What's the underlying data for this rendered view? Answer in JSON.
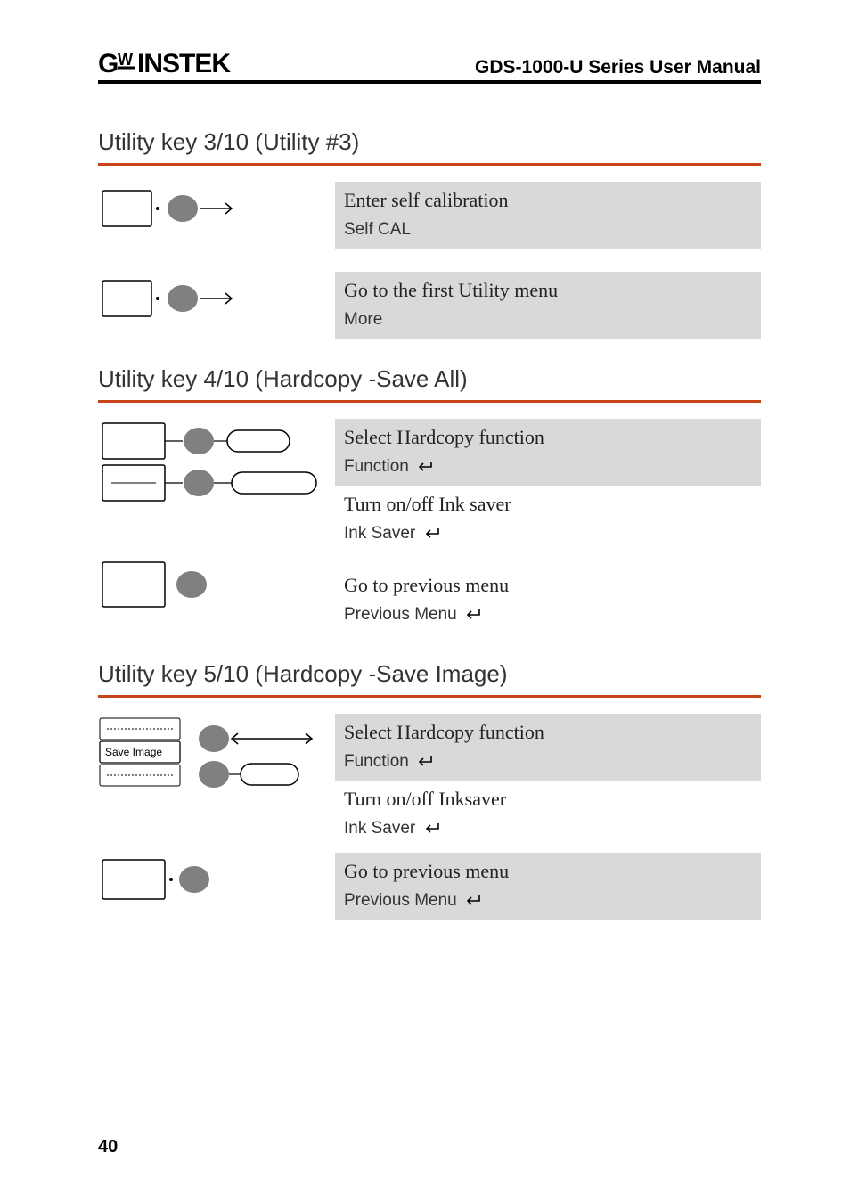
{
  "header": {
    "brand_prefix": "G",
    "brand_super": "W",
    "brand_rest": "INSTEK",
    "manual_title": "GDS-1000-U Series User Manual"
  },
  "sections": [
    {
      "title": "Utility key 3/10 (Utility #3)",
      "rows": [
        {
          "top": "Enter self calibration",
          "bottom": "Self CAL",
          "shaded": true
        },
        {
          "top": "Go to the first Utility menu",
          "bottom": "More",
          "shaded": true
        }
      ]
    },
    {
      "title": "Utility key 4/10 (Hardcopy -Save All)",
      "rows": [
        {
          "top": "Select Hardcopy function",
          "bottom": "Function",
          "enter": true,
          "shaded": true
        },
        {
          "top": "Turn on/off Ink saver",
          "bottom": "Ink Saver",
          "enter": true,
          "shaded": false
        },
        {
          "top": "Go to previous menu",
          "bottom": "Previous Menu",
          "enter": true,
          "shaded": false
        }
      ]
    },
    {
      "title": "Utility key 5/10 (Hardcopy -Save Image)",
      "rows": [
        {
          "top": "Select Hardcopy function",
          "bottom": "Function",
          "enter": true,
          "shaded": true
        },
        {
          "top": "Turn on/off Inksaver",
          "bottom": "Ink Saver",
          "enter": true,
          "shaded": false
        },
        {
          "top": "Go to previous menu",
          "bottom": "Previous Menu",
          "enter": true,
          "shaded": true
        }
      ],
      "save_image_label": "Save Image"
    }
  ],
  "page_number": "40"
}
